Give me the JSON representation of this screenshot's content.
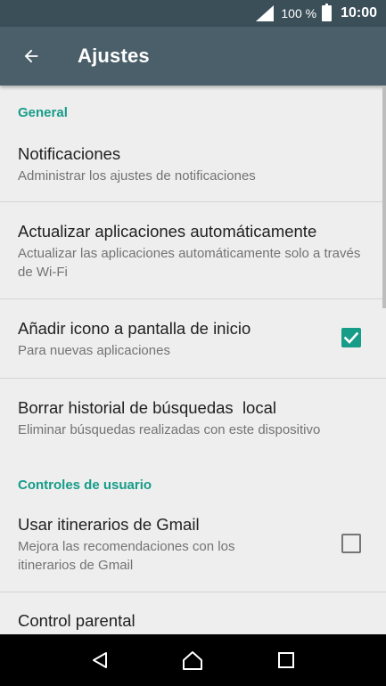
{
  "status_bar": {
    "battery_percent": "100 %",
    "time": "10:00"
  },
  "app_bar": {
    "title": "Ajustes",
    "back_icon": "arrow-back-icon"
  },
  "sections": [
    {
      "header": "General",
      "items": [
        {
          "title": "Notificaciones",
          "subtitle": "Administrar los ajustes de notificaciones"
        },
        {
          "title": "Actualizar aplicaciones automáticamente",
          "subtitle": "Actualizar las aplicaciones automáticamente solo a través de Wi-Fi"
        },
        {
          "title": "Añadir icono a pantalla de inicio",
          "subtitle": "Para nuevas aplicaciones",
          "checked": true
        },
        {
          "title": "Borrar historial de búsquedas  local",
          "subtitle": "Eliminar búsquedas realizadas con este dispositivo"
        }
      ]
    },
    {
      "header": "Controles de usuario",
      "items": [
        {
          "title": "Usar itinerarios de Gmail",
          "subtitle": "Mejora las recomendaciones con los itinerarios de Gmail",
          "checked": false
        },
        {
          "title": "Control parental"
        }
      ]
    }
  ],
  "nav_bar": {
    "back_icon": "triangle-back-icon",
    "home_icon": "home-icon",
    "recents_icon": "recents-square-icon"
  },
  "colors": {
    "status_bar": "#3b4f59",
    "app_bar": "#4a5f69",
    "accent": "#169c89",
    "background": "#eeeeee"
  }
}
